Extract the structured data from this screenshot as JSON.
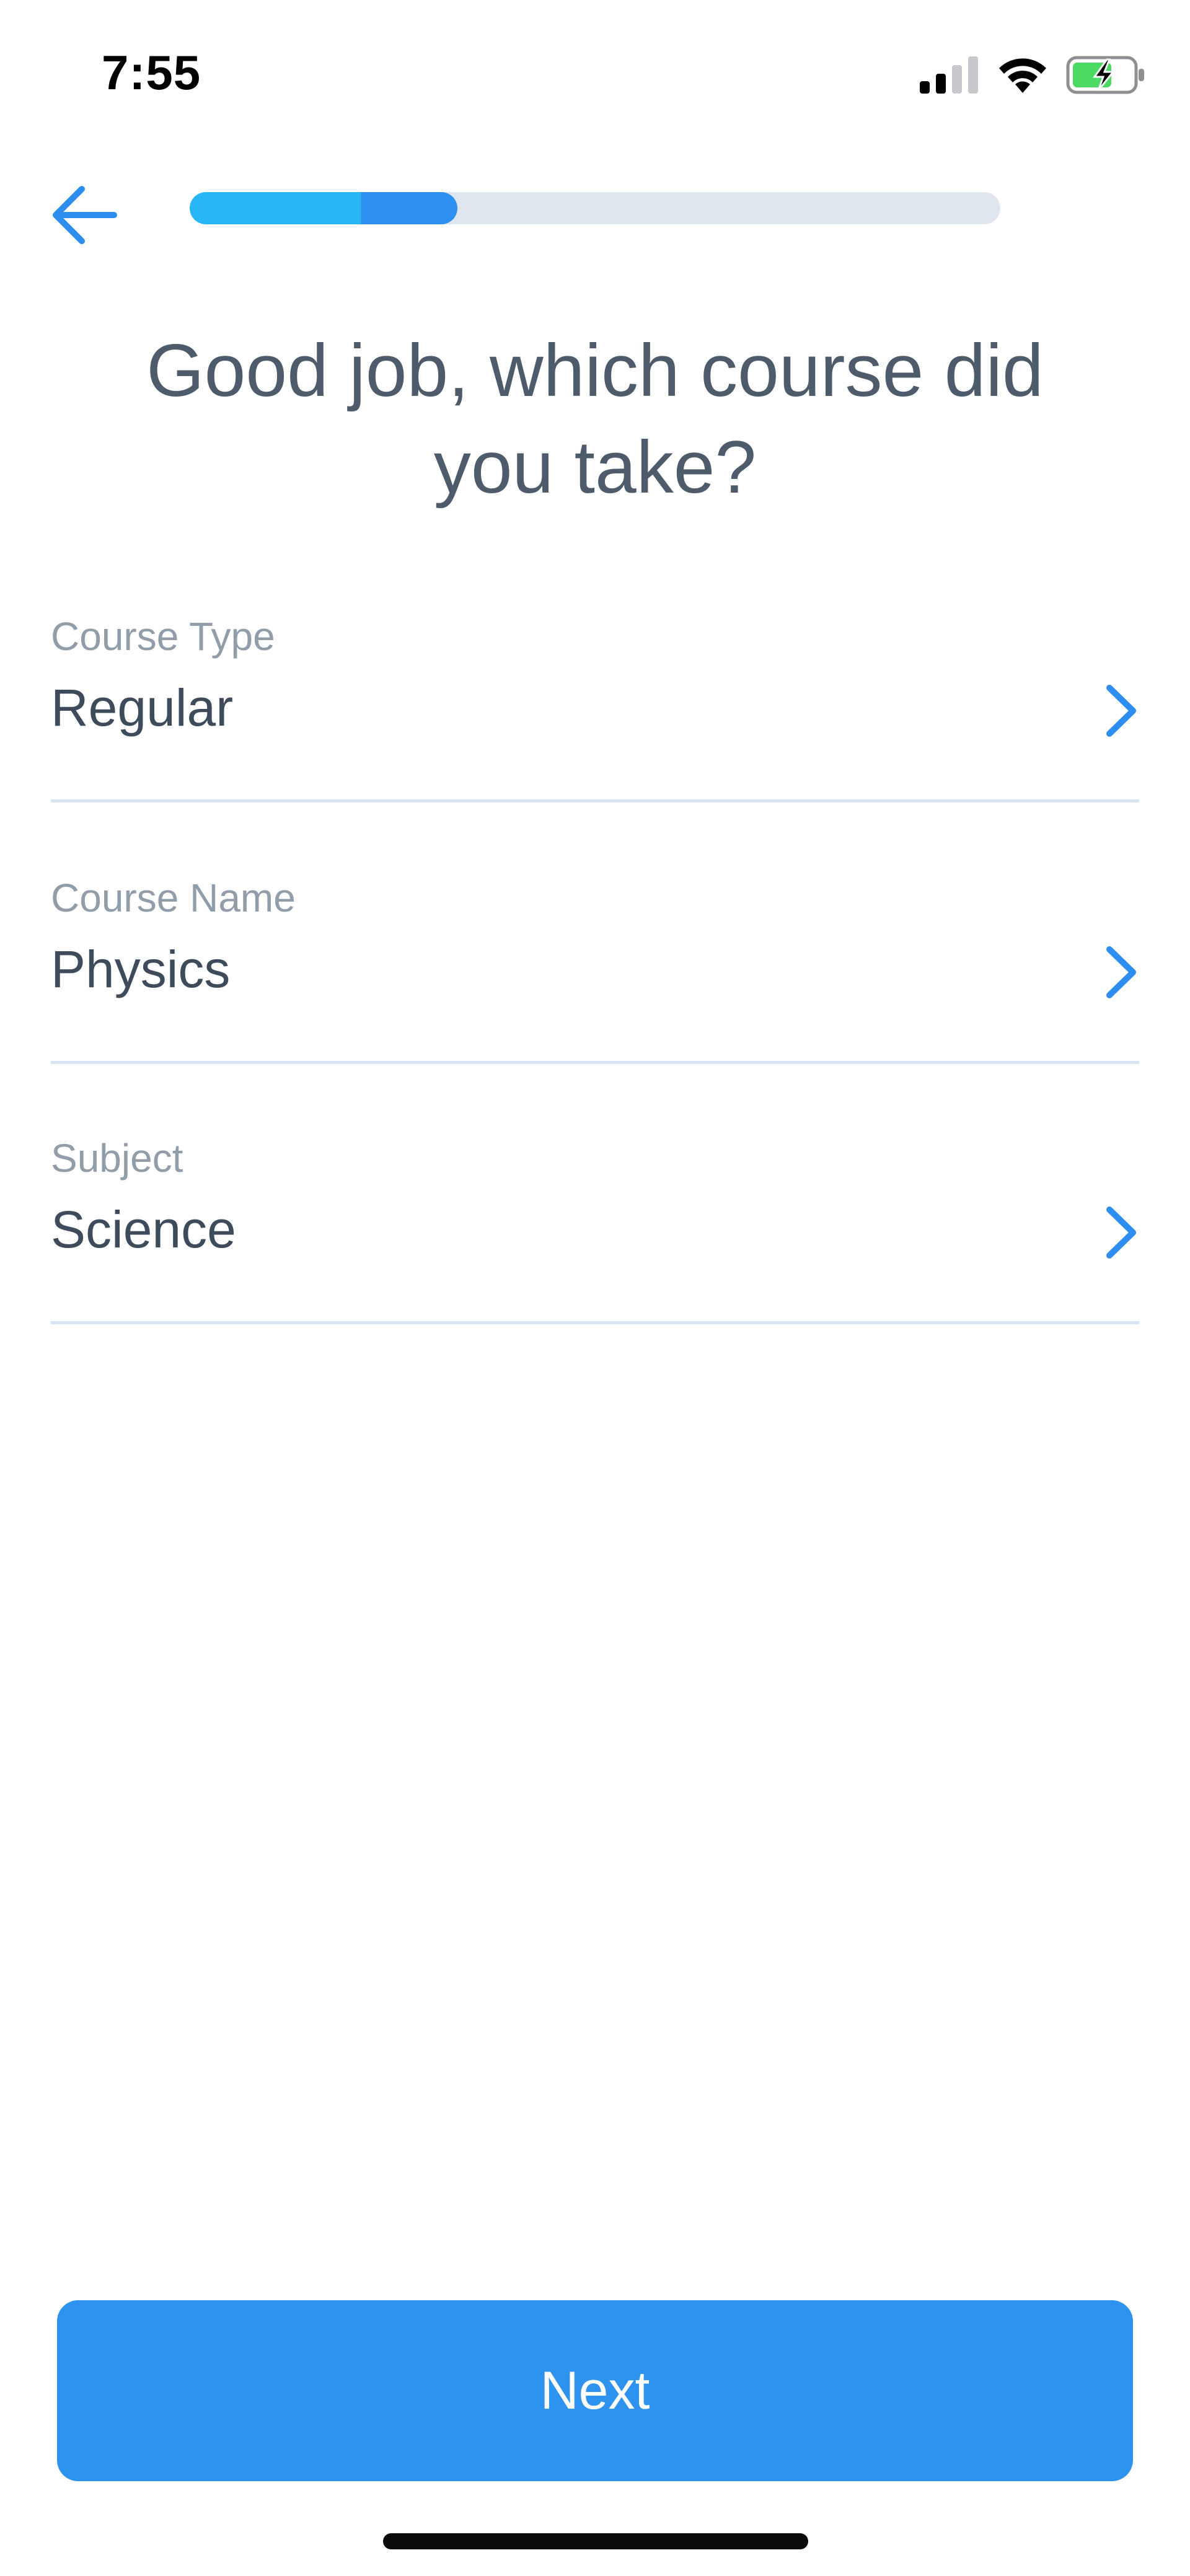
{
  "status_bar": {
    "time": "7:55",
    "icons": [
      "cellular-signal-icon",
      "wifi-icon",
      "battery-charging-icon"
    ]
  },
  "nav": {
    "back_icon": "arrow-left-icon",
    "progress_fraction": 0.33,
    "accent_color": "#2e93ef"
  },
  "heading": "Good job, which course did you take?",
  "fields": [
    {
      "label": "Course Type",
      "value": "Regular"
    },
    {
      "label": "Course Name",
      "value": "Physics"
    },
    {
      "label": "Subject",
      "value": "Science"
    }
  ],
  "next_button": {
    "label": "Next"
  }
}
